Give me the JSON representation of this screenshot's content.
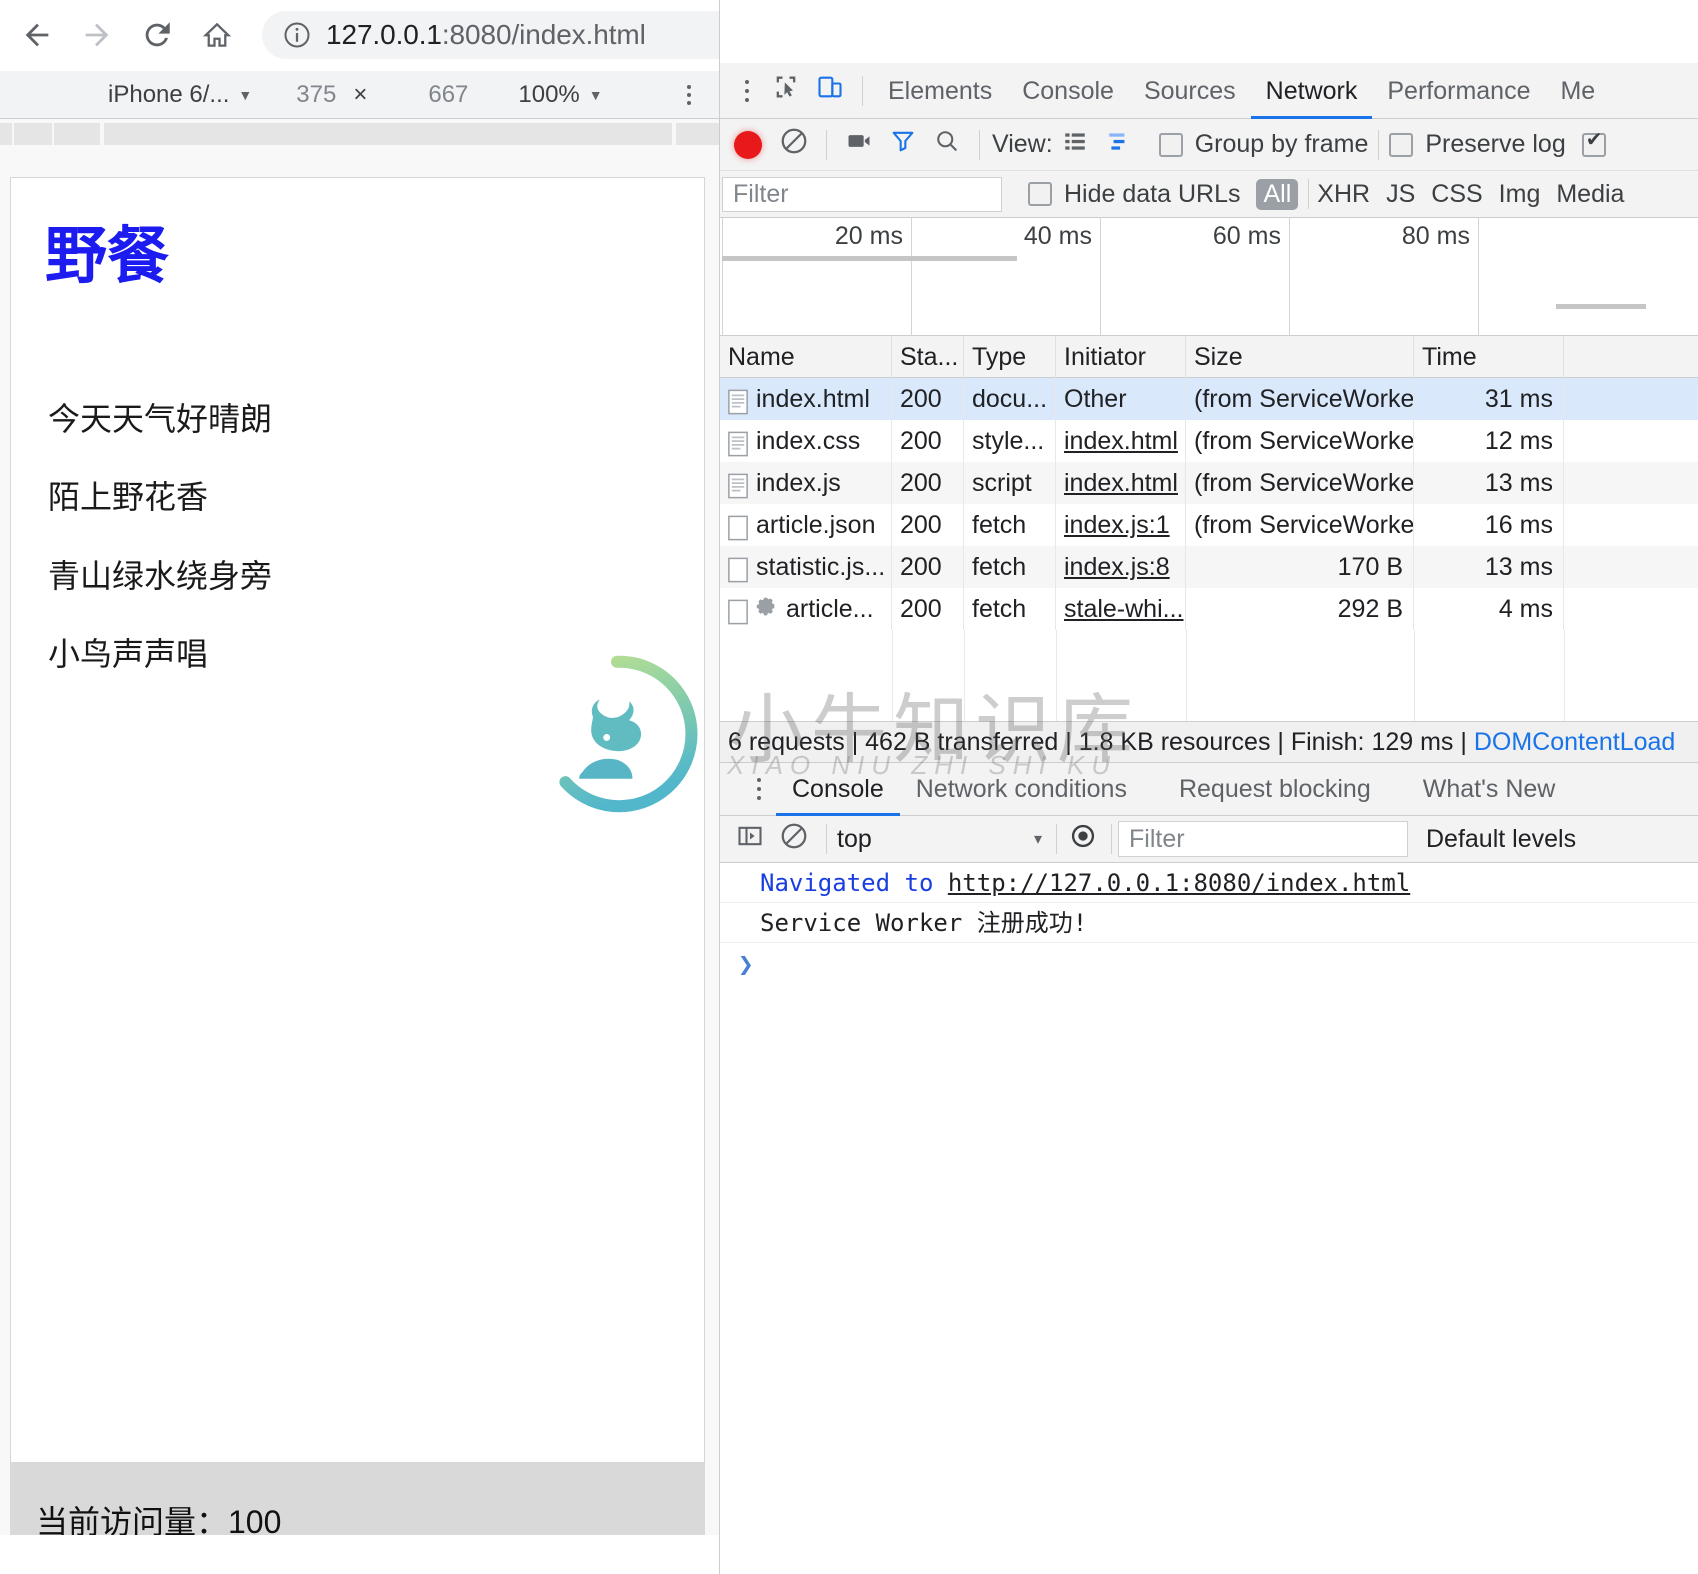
{
  "browser": {
    "url_host": "127.0.0.1",
    "url_rest": ":8080/index.html",
    "back_icon": "back-arrow-icon",
    "forward_icon": "forward-arrow-icon",
    "reload_icon": "reload-icon",
    "home_icon": "home-icon",
    "info_icon": "info-circle-icon",
    "bookmark_icon": "star-icon"
  },
  "device_toolbar": {
    "device": "iPhone 6/...",
    "width": "375",
    "times": "×",
    "height": "667",
    "zoom": "100%",
    "more_icon": "kebab-menu-icon"
  },
  "page": {
    "title": "野餐",
    "lines": [
      "今天天气好晴朗",
      "陌上野花香",
      "青山绿水绕身旁",
      "小鸟声声唱"
    ],
    "visit_count_label": "当前访问量：100"
  },
  "devtools": {
    "tabs": [
      {
        "label": "Elements",
        "active": false
      },
      {
        "label": "Console",
        "active": false
      },
      {
        "label": "Sources",
        "active": false
      },
      {
        "label": "Network",
        "active": true
      },
      {
        "label": "Performance",
        "active": false
      },
      {
        "label": "Me",
        "active": false
      }
    ],
    "inspect_icon": "inspect-element-icon",
    "device_toggle_icon": "device-toolbar-icon",
    "more_icon": "kebab-menu-icon",
    "network_toolbar": {
      "record_icon": "record-button-icon",
      "clear_icon": "clear-no-entry-icon",
      "capture_screenshots_icon": "camera-icon",
      "filter_icon": "funnel-icon",
      "search_icon": "magnifier-icon",
      "view_label": "View:",
      "list_view_icon": "list-view-icon",
      "waterfall_view_icon": "waterfall-view-icon",
      "group_by_frame": "Group by frame",
      "preserve_log": "Preserve log",
      "disable_cache_checked": true
    },
    "filter_bar": {
      "filter_placeholder": "Filter",
      "hide_data_urls": "Hide data URLs",
      "types": [
        "All",
        "XHR",
        "JS",
        "CSS",
        "Img",
        "Media"
      ],
      "selected_type": "All"
    },
    "overview_ticks": [
      "20 ms",
      "40 ms",
      "60 ms",
      "80 ms"
    ],
    "table": {
      "columns": [
        "Name",
        "Sta...",
        "Type",
        "Initiator",
        "Size",
        "Time"
      ],
      "rows": [
        {
          "name": "index.html",
          "icon": "document-icon",
          "status": "200",
          "type": "docu...",
          "initiator": "Other",
          "initiator_link": false,
          "size": "(from ServiceWorker)",
          "size_muted": true,
          "time": "31 ms",
          "selected": true
        },
        {
          "name": "index.css",
          "icon": "document-icon",
          "status": "200",
          "type": "style...",
          "initiator": "index.html",
          "initiator_link": true,
          "size": "(from ServiceWorker)",
          "size_muted": true,
          "time": "12 ms",
          "selected": false
        },
        {
          "name": "index.js",
          "icon": "document-icon",
          "status": "200",
          "type": "script",
          "initiator": "index.html",
          "initiator_link": true,
          "size": "(from ServiceWorker)",
          "size_muted": true,
          "time": "13 ms",
          "selected": false
        },
        {
          "name": "article.json",
          "icon": "blank-doc-icon",
          "status": "200",
          "type": "fetch",
          "initiator": "index.js:1",
          "initiator_link": true,
          "size": "(from ServiceWorker)",
          "size_muted": true,
          "time": "16 ms",
          "selected": false
        },
        {
          "name": "statistic.js...",
          "icon": "blank-doc-icon",
          "status": "200",
          "type": "fetch",
          "initiator": "index.js:8",
          "initiator_link": true,
          "size": "170 B",
          "size_muted": false,
          "time": "13 ms",
          "selected": false
        },
        {
          "name": "article...",
          "icon": "blank-doc-icon",
          "badge_icon": "gear-icon",
          "status": "200",
          "type": "fetch",
          "initiator": "stale-whi...",
          "initiator_link": true,
          "size": "292 B",
          "size_muted": false,
          "time": "4 ms",
          "selected": false
        }
      ]
    },
    "status_bar": {
      "requests": "6 requests",
      "transferred": "462 B transferred",
      "resources": "1.8 KB resources",
      "finish": "Finish: 129 ms",
      "domcontentloaded": "DOMContentLoad"
    },
    "drawer_tabs": [
      {
        "label": "Console",
        "active": true
      },
      {
        "label": "Network conditions",
        "active": false
      },
      {
        "label": "Request blocking",
        "active": false
      },
      {
        "label": "What's New",
        "active": false
      }
    ],
    "drawer_more_icon": "kebab-menu-icon",
    "console_toolbar": {
      "sidebar_icon": "console-sidebar-icon",
      "clear_icon": "clear-no-entry-icon",
      "context": "top",
      "context_caret": "▾",
      "eye_icon": "live-expression-eye-icon",
      "filter_placeholder": "Filter",
      "levels": "Default levels"
    },
    "console_messages": [
      {
        "prefix": "Navigated to ",
        "url": "http://127.0.0.1:8080/index.html",
        "kind": "navigation"
      },
      {
        "text": "Service Worker 注册成功!",
        "kind": "log"
      }
    ],
    "console_prompt": "❯"
  },
  "watermark": {
    "text_cn": "小牛知识库",
    "text_pinyin": "XIAO NIU ZHI SHI KU",
    "logo_icon": "bull-logo-icon"
  },
  "colors": {
    "accent": "#1a73e8",
    "record": "#e8191b",
    "title": "#1c1cf0",
    "selected_row": "#d9e8fb",
    "toolbar_bg": "#f3f3f3"
  }
}
